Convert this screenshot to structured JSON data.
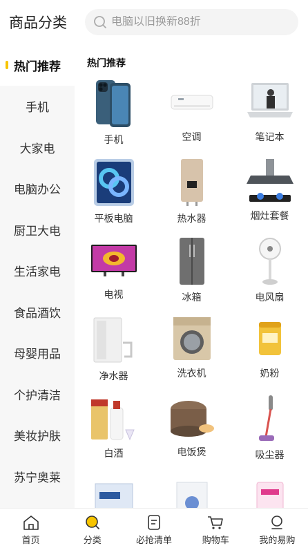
{
  "header": {
    "title": "商品分类"
  },
  "search": {
    "placeholder": "电脑以旧换新88折",
    "icon": "search-icon"
  },
  "sidebar": {
    "items": [
      {
        "label": "热门推荐",
        "active": true
      },
      {
        "label": "手机"
      },
      {
        "label": "大家电"
      },
      {
        "label": "电脑办公"
      },
      {
        "label": "厨卫大电"
      },
      {
        "label": "生活家电"
      },
      {
        "label": "食品酒饮"
      },
      {
        "label": "母婴用品"
      },
      {
        "label": "个护清洁"
      },
      {
        "label": "美妆护肤"
      },
      {
        "label": "苏宁奥莱"
      }
    ]
  },
  "content": {
    "section_title": "热门推荐",
    "products": [
      {
        "label": "手机",
        "icon": "phone-image"
      },
      {
        "label": "空调",
        "icon": "air-conditioner-image"
      },
      {
        "label": "笔记本",
        "icon": "laptop-image"
      },
      {
        "label": "平板电脑",
        "icon": "tablet-image"
      },
      {
        "label": "热水器",
        "icon": "water-heater-image"
      },
      {
        "label": "烟灶套餐",
        "icon": "range-hood-image"
      },
      {
        "label": "电视",
        "icon": "tv-image"
      },
      {
        "label": "冰箱",
        "icon": "fridge-image"
      },
      {
        "label": "电风扇",
        "icon": "fan-image"
      },
      {
        "label": "净水器",
        "icon": "water-purifier-image"
      },
      {
        "label": "洗衣机",
        "icon": "washing-machine-image"
      },
      {
        "label": "奶粉",
        "icon": "milk-powder-image"
      },
      {
        "label": "白酒",
        "icon": "liquor-image"
      },
      {
        "label": "电饭煲",
        "icon": "rice-cooker-image"
      },
      {
        "label": "吸尘器",
        "icon": "vacuum-image"
      }
    ]
  },
  "tabbar": {
    "items": [
      {
        "label": "首页",
        "icon": "home-icon"
      },
      {
        "label": "分类",
        "icon": "category-icon",
        "active": true
      },
      {
        "label": "必抢清单",
        "icon": "list-icon"
      },
      {
        "label": "购物车",
        "icon": "cart-icon"
      },
      {
        "label": "我的易购",
        "icon": "profile-icon"
      }
    ]
  },
  "colors": {
    "accent": "#f7c400",
    "sidebar_bg": "#f7f7f7",
    "search_bg": "#f4f4f4"
  }
}
